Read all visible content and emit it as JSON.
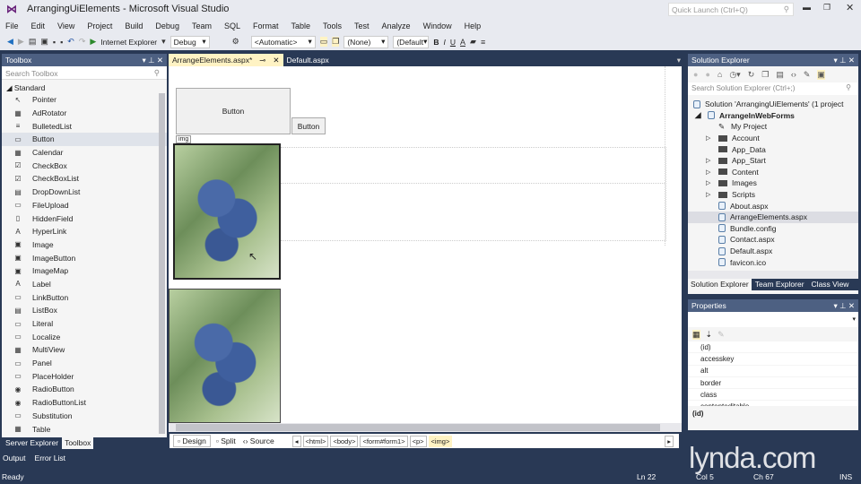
{
  "window": {
    "title": "ArrangingUiElements - Microsoft Visual Studio",
    "quick_launch_placeholder": "Quick Launch (Ctrl+Q)"
  },
  "menu": [
    "File",
    "Edit",
    "View",
    "Project",
    "Build",
    "Debug",
    "Team",
    "SQL",
    "Format",
    "Table",
    "Tools",
    "Test",
    "Analyze",
    "Window",
    "Help"
  ],
  "toolbar": {
    "browser": "Internet Explorer",
    "config": "Debug",
    "target": "<Automatic>",
    "style": "(None)",
    "font": "(Default",
    "bold": "B",
    "italic": "I",
    "underline": "U"
  },
  "toolbox": {
    "title": "Toolbox",
    "search_placeholder": "Search Toolbox",
    "group": "Standard",
    "selected": "Button",
    "items": [
      {
        "label": "Pointer",
        "icon": "↖"
      },
      {
        "label": "AdRotator",
        "icon": "▦"
      },
      {
        "label": "BulletedList",
        "icon": "≡"
      },
      {
        "label": "Button",
        "icon": "▭"
      },
      {
        "label": "Calendar",
        "icon": "▦"
      },
      {
        "label": "CheckBox",
        "icon": "☑"
      },
      {
        "label": "CheckBoxList",
        "icon": "☑"
      },
      {
        "label": "DropDownList",
        "icon": "▤"
      },
      {
        "label": "FileUpload",
        "icon": "▭"
      },
      {
        "label": "HiddenField",
        "icon": "▯"
      },
      {
        "label": "HyperLink",
        "icon": "A"
      },
      {
        "label": "Image",
        "icon": "▣"
      },
      {
        "label": "ImageButton",
        "icon": "▣"
      },
      {
        "label": "ImageMap",
        "icon": "▣"
      },
      {
        "label": "Label",
        "icon": "A"
      },
      {
        "label": "LinkButton",
        "icon": "▭"
      },
      {
        "label": "ListBox",
        "icon": "▤"
      },
      {
        "label": "Literal",
        "icon": "▭"
      },
      {
        "label": "Localize",
        "icon": "▭"
      },
      {
        "label": "MultiView",
        "icon": "▦"
      },
      {
        "label": "Panel",
        "icon": "▭"
      },
      {
        "label": "PlaceHolder",
        "icon": "▭"
      },
      {
        "label": "RadioButton",
        "icon": "◉"
      },
      {
        "label": "RadioButtonList",
        "icon": "◉"
      },
      {
        "label": "Substitution",
        "icon": "▭"
      },
      {
        "label": "Table",
        "icon": "▦"
      }
    ]
  },
  "left_tabs": [
    "Server Explorer",
    "Toolbox"
  ],
  "bottom_tabs": [
    "Output",
    "Error List"
  ],
  "editor": {
    "tabs": [
      {
        "label": "ArrangeElements.aspx*",
        "active": true
      },
      {
        "label": "Default.aspx",
        "active": false
      }
    ],
    "button1": "Button",
    "button2": "Button",
    "img_tag": "img",
    "views": [
      "Design",
      "Split",
      "Source"
    ],
    "breadcrumbs": [
      "<html>",
      "<body>",
      "<form#form1>",
      "<p>",
      "<img>"
    ]
  },
  "solution_explorer": {
    "title": "Solution Explorer",
    "search_placeholder": "Search Solution Explorer (Ctrl+;)",
    "solution": "Solution 'ArrangingUiElements' (1 project",
    "project": "ArrangeInWebForms",
    "items": [
      {
        "label": "My Project",
        "type": "wrench",
        "expander": false
      },
      {
        "label": "Account",
        "type": "folder",
        "expander": true
      },
      {
        "label": "App_Data",
        "type": "folder",
        "expander": false
      },
      {
        "label": "App_Start",
        "type": "folder",
        "expander": true
      },
      {
        "label": "Content",
        "type": "folder",
        "expander": true
      },
      {
        "label": "Images",
        "type": "folder",
        "expander": true
      },
      {
        "label": "Scripts",
        "type": "folder",
        "expander": true
      },
      {
        "label": "About.aspx",
        "type": "file",
        "expander": false
      },
      {
        "label": "ArrangeElements.aspx",
        "type": "file",
        "expander": false,
        "selected": true
      },
      {
        "label": "Bundle.config",
        "type": "file",
        "expander": false
      },
      {
        "label": "Contact.aspx",
        "type": "file",
        "expander": false
      },
      {
        "label": "Default.aspx",
        "type": "file",
        "expander": false
      },
      {
        "label": "favicon.ico",
        "type": "file",
        "expander": false
      }
    ],
    "tabs": [
      "Solution Explorer",
      "Team Explorer",
      "Class View"
    ]
  },
  "properties": {
    "title": "Properties",
    "rows": [
      "(id)",
      "accesskey",
      "alt",
      "border",
      "class",
      "contenteditable"
    ],
    "description": "(id)"
  },
  "status": {
    "text": "Ready",
    "ln": "Ln 22",
    "col": "Col 5",
    "ch": "Ch 67",
    "mode": "INS"
  },
  "watermark": "lynda.com",
  "colors": {
    "chrome": "#e8eaf0",
    "dark": "#293955",
    "panel_header": "#4d6082",
    "active_tab": "#fff3c4"
  }
}
